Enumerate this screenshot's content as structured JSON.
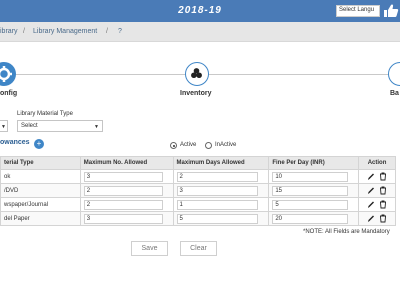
{
  "header": {
    "year": "2018-19",
    "language_select": "Select Langu",
    "thumb_icon": "thumbs-up-icon"
  },
  "breadcrumb": {
    "item1": "ibrary",
    "item2": "Library Management",
    "item3": "?"
  },
  "wizard": {
    "steps": [
      {
        "label": "onfig",
        "icon": "gear-icon",
        "state": "active"
      },
      {
        "label": "Inventory",
        "icon": "books-icon",
        "state": "inactive"
      },
      {
        "label": "Ba",
        "icon": "",
        "state": "inactive"
      }
    ]
  },
  "filters": {
    "library_material_type_label": "Library Material Type",
    "library_material_type_value": "Select"
  },
  "allowances": {
    "title": "owances",
    "status_active": "Active",
    "status_inactive": "InActive",
    "selected_status": "Active"
  },
  "table": {
    "headers": [
      "terial Type",
      "Maximum No. Allowed",
      "Maximum Days Allowed",
      "Fine Per Day (INR)",
      "Action"
    ],
    "rows": [
      {
        "type": "ok",
        "max_no": "3",
        "max_days": "2",
        "fine": "10"
      },
      {
        "type": "/DVD",
        "max_no": "2",
        "max_days": "3",
        "fine": "15"
      },
      {
        "type": "wspaper/Journal",
        "max_no": "2",
        "max_days": "1",
        "fine": "5"
      },
      {
        "type": "del Paper",
        "max_no": "3",
        "max_days": "5",
        "fine": "20"
      }
    ]
  },
  "note": "*NOTE: All Fields are Mandatory",
  "buttons": {
    "save": "Save",
    "clear": "Clear"
  },
  "colors": {
    "primary": "#4a7bb7",
    "accent": "#3f86c7"
  }
}
